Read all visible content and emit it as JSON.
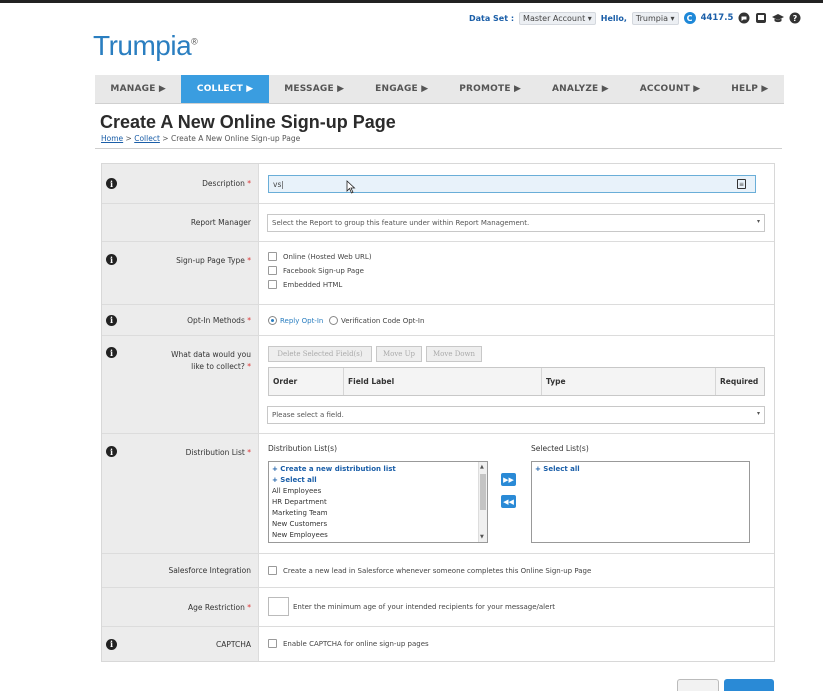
{
  "utility": {
    "dataset_label": "Data Set :",
    "dataset_value": "Master Account",
    "hello_label": "Hello,",
    "user": "Trumpia",
    "credits_letter": "C",
    "credits": "4417.5",
    "icons": [
      "chat-icon",
      "support-icon",
      "education-icon",
      "help-icon"
    ]
  },
  "logo": {
    "text": "Trumpia",
    "reg": "®"
  },
  "nav": {
    "tabs": [
      {
        "label": "MANAGE ▶",
        "active": false
      },
      {
        "label": "COLLECT ▶",
        "active": true
      },
      {
        "label": "MESSAGE ▶",
        "active": false
      },
      {
        "label": "ENGAGE ▶",
        "active": false
      },
      {
        "label": "PROMOTE ▶",
        "active": false
      },
      {
        "label": "ANALYZE ▶",
        "active": false
      },
      {
        "label": "ACCOUNT ▶",
        "active": false
      },
      {
        "label": "HELP ▶",
        "active": false
      }
    ]
  },
  "page": {
    "title": "Create A New Online Sign-up Page",
    "breadcrumb": {
      "home": "Home",
      "sep1": " > ",
      "collect": "Collect",
      "sep2": " > ",
      "current": "Create A New Online Sign-up Page"
    }
  },
  "form": {
    "description": {
      "label": "Description",
      "value": "vs|"
    },
    "report_manager": {
      "label": "Report Manager",
      "placeholder": "Select the Report to group this feature under within Report Management."
    },
    "signup_type": {
      "label": "Sign-up Page Type",
      "options": [
        "Online (Hosted Web URL)",
        "Facebook Sign-up Page",
        "Embedded HTML"
      ]
    },
    "optin": {
      "label": "Opt-In Methods",
      "options": [
        "Reply Opt-In",
        "Verification Code Opt-In"
      ]
    },
    "data_collect": {
      "label_line1": "What data would you",
      "label_line2": "like to collect?",
      "buttons": [
        "Delete Selected Field(s)",
        "Move Up",
        "Move Down"
      ],
      "columns": [
        "Order",
        "Field Label",
        "Type",
        "Required"
      ],
      "select_placeholder": "Please select a field."
    },
    "distribution": {
      "label": "Distribution List",
      "lists_header": "Distribution List(s)",
      "selected_header": "Selected List(s)",
      "lists": [
        "+ Create a new distribution list",
        "+ Select all",
        "All Employees",
        "HR Department",
        "Marketing Team",
        "New Customers",
        "New Employees"
      ],
      "selected": [
        "+ Select all"
      ]
    },
    "salesforce": {
      "label": "Salesforce Integration",
      "text": "Create a new lead in Salesforce whenever someone completes this Online Sign-up Page"
    },
    "age": {
      "label": "Age Restriction",
      "text": "Enter the minimum age of your intended recipients for your message/alert"
    },
    "captcha": {
      "label": "CAPTCHA",
      "text": "Enable CAPTCHA for online sign-up pages"
    },
    "required_mark": "*",
    "info_glyph": "i"
  },
  "colors": {
    "accent": "#3a9de0",
    "link": "#1a5ea8",
    "brand": "#2a7ec0"
  }
}
